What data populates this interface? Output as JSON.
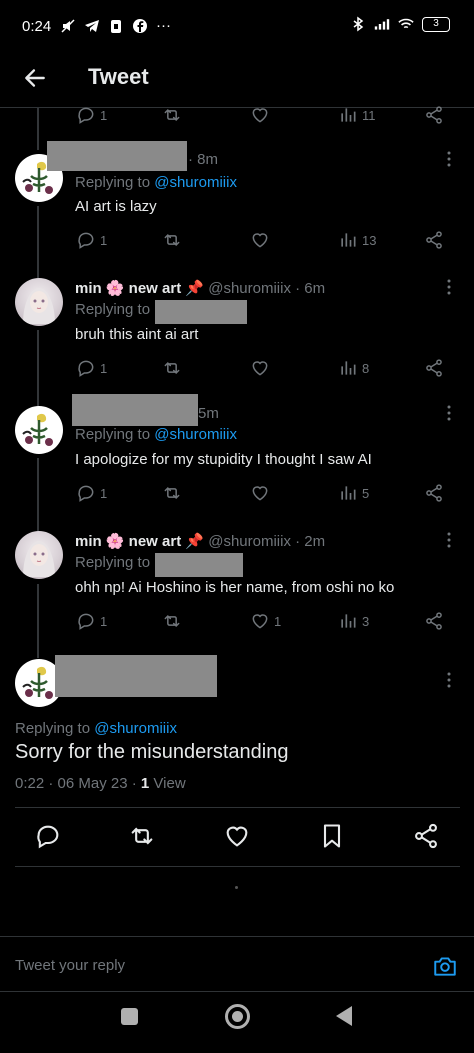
{
  "status_bar": {
    "time": "0:24",
    "battery": "3"
  },
  "header": {
    "title": "Tweet"
  },
  "top_partial": {
    "replies": "1",
    "views": "11"
  },
  "tweets": [
    {
      "time": "· 8m",
      "replying_prefix": "Replying to ",
      "replying_handle": "@shuromiiix",
      "text": "AI art is lazy",
      "replies": "1",
      "likes": "",
      "views": "13"
    },
    {
      "name": "min 🌸 new art 📌",
      "handle_time": "@shuromiiix · 6m",
      "replying_prefix": "Replying to",
      "replying_handle": "",
      "text": "bruh this aint ai art",
      "replies": "1",
      "likes": "",
      "views": "8"
    },
    {
      "time": "5m",
      "replying_prefix": "Replying to ",
      "replying_handle": "@shuromiiix",
      "text": "I apologize for my stupidity I thought I saw AI",
      "replies": "1",
      "likes": "",
      "views": "5"
    },
    {
      "name": "min 🌸 new art 📌",
      "handle_time": "@shuromiiix · 2m",
      "replying_prefix": "Replying to",
      "replying_handle": "",
      "text": "ohh np! Ai Hoshino is her name, from oshi no ko",
      "replies": "1",
      "likes": "1",
      "views": "3"
    }
  ],
  "focused": {
    "replying_prefix": "Replying to ",
    "replying_handle": "@shuromiiix",
    "text": "Sorry for the misunderstanding",
    "timestamp": "0:22 · 06 May 23 · ",
    "views_count": "1",
    "views_label": " View"
  },
  "reply_bar": {
    "placeholder": "Tweet your reply"
  },
  "colors": {
    "accent": "#1d9bf0",
    "muted": "#71767b",
    "text": "#e7e9ea",
    "background": "#000000"
  }
}
